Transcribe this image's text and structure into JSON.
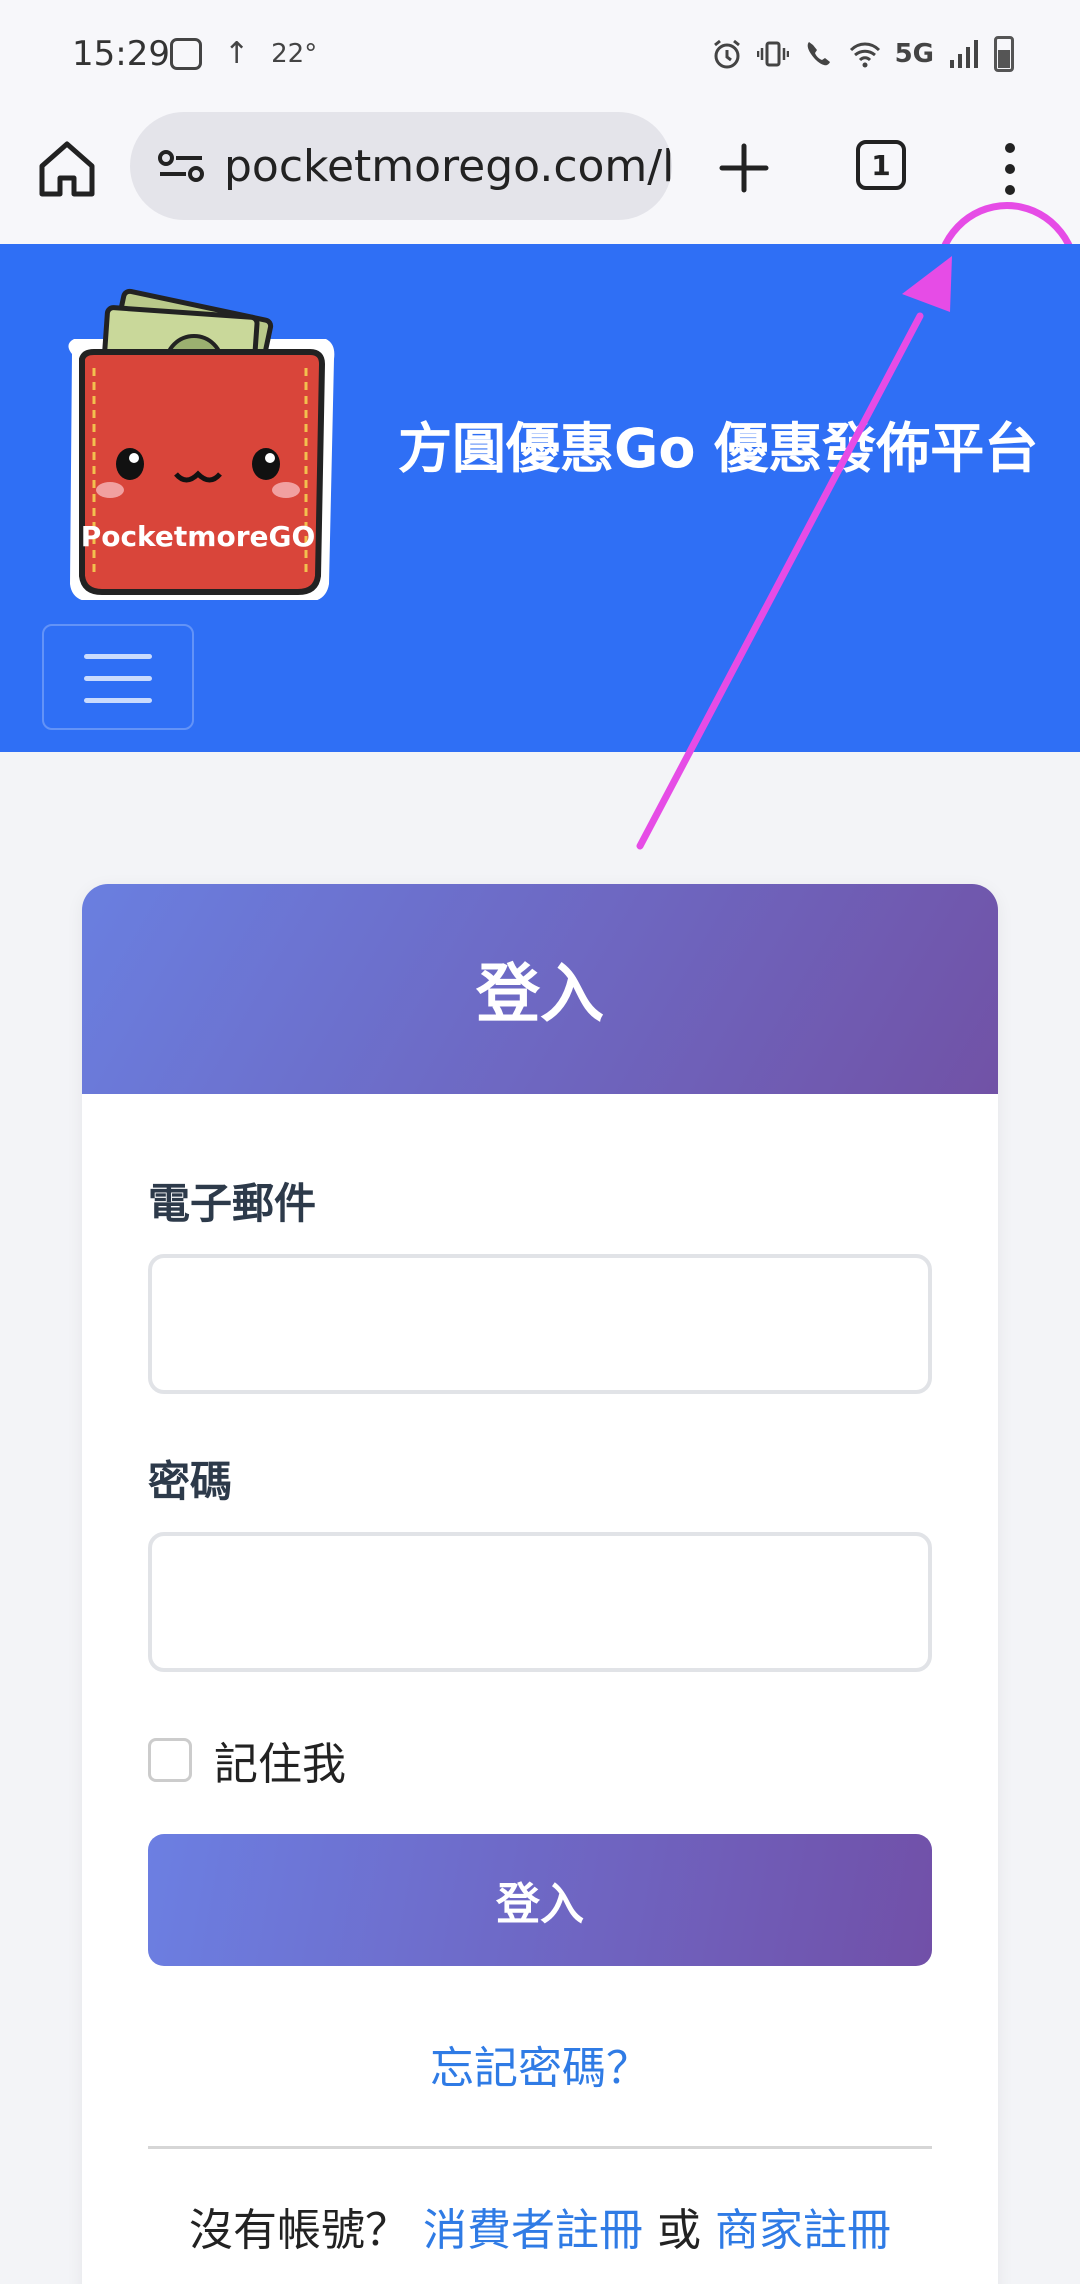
{
  "status_bar": {
    "time": "15:29",
    "upload_arrow": "↑",
    "temperature": "22°",
    "network": "5G"
  },
  "browser": {
    "url": "pocketmorego.com/lo",
    "tab_count": "1"
  },
  "header": {
    "logo_text": "PocketmoreGO",
    "site_title": "方圓優惠Go 優惠發佈平台"
  },
  "login": {
    "title": "登入",
    "email_label": "電子郵件",
    "password_label": "密碼",
    "remember_label": "記住我",
    "submit_label": "登入",
    "forgot_link": "忘記密碼？",
    "no_account_text": "沒有帳號？",
    "consumer_register": "消費者註冊",
    "or_text": "或",
    "merchant_register": "商家註冊"
  },
  "colors": {
    "header_blue": "#2f6ff5",
    "gradient_start": "#6a7fe0",
    "gradient_end": "#7152a6",
    "link_blue": "#2f7be5",
    "annotation_magenta": "#e64ce6"
  }
}
